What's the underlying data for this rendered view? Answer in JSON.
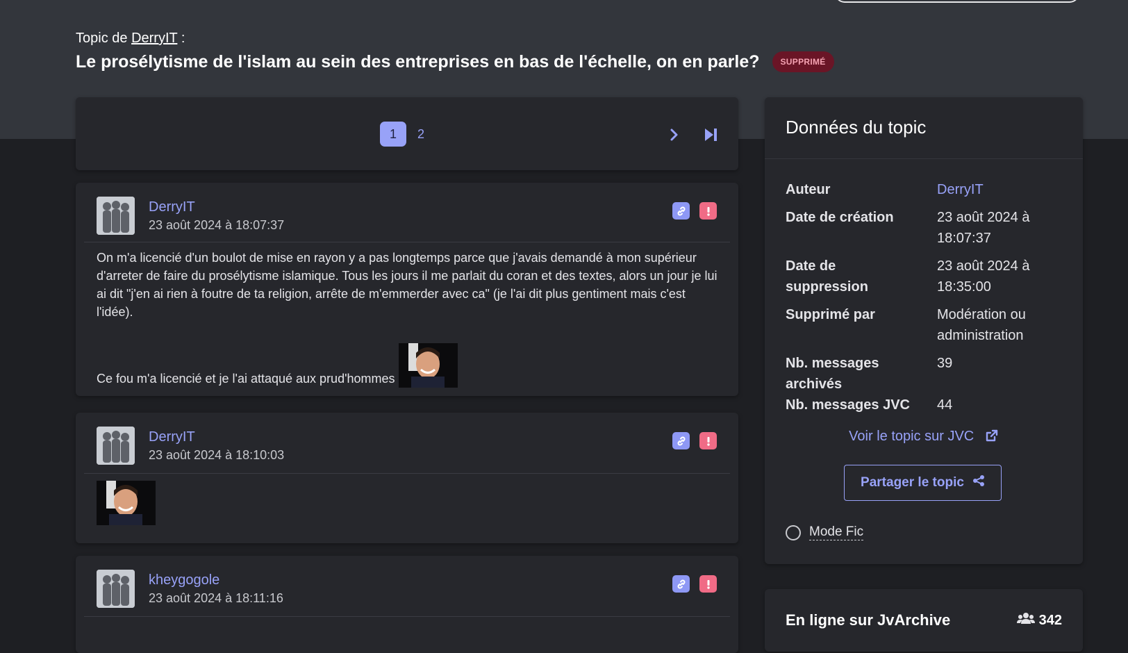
{
  "header": {
    "topic_by_prefix": "Topic de ",
    "topic_author": "DerryIT",
    "topic_by_suffix": " :",
    "title": "Le prosélytisme de l'islam au sein des entreprises en bas de l'échelle, on en parle?",
    "badge": "SUPPRIMÉ"
  },
  "pagination": {
    "pages": [
      "1",
      "2"
    ],
    "current": "1",
    "icons": [
      "chevron-right-icon",
      "skip-to-last-icon"
    ]
  },
  "posts": [
    {
      "author": "DerryIT",
      "date": "23 août 2024 à 18:07:37",
      "paragraphs": [
        "On m'a licencié d'un boulot de mise en rayon y a pas longtemps parce que j'avais demandé à mon supérieur d'arreter de faire du prosélytisme islamique. Tous les jours il me parlait du coran et des textes, alors un jour je lui ai dit \"j'en ai rien à foutre de ta religion, arrête de m'emmerder avec ca\" (je l'ai dit plus gentiment mais c'est l'idée).",
        "Ce fou m'a licencié et je l'ai attaqué aux prud'hommes"
      ]
    },
    {
      "author": "DerryIT",
      "date": "23 août 2024 à 18:10:03"
    },
    {
      "author": "kheygogole",
      "date": "23 août 2024 à 18:11:16"
    }
  ],
  "sidebar": {
    "title": "Données du topic",
    "rows": [
      {
        "label": "Auteur",
        "value": "DerryIT"
      },
      {
        "label": "Date de création",
        "value": "23 août 2024 à 18:07:37"
      },
      {
        "label": "Date de suppression",
        "value": "23 août 2024 à 18:35:00"
      },
      {
        "label": "Supprimé par",
        "value": "Modération ou administration"
      },
      {
        "label": "Nb. messages archivés",
        "value": "39"
      },
      {
        "label": "Nb. messages JVC",
        "value": "44"
      }
    ],
    "jvc_link": "Voir le topic sur JVC",
    "share_button": "Partager le topic",
    "mode_fic": "Mode Fic"
  },
  "online": {
    "title": "En ligne sur JvArchive",
    "count": "342"
  },
  "colors": {
    "accent": "#98a2f8",
    "danger": "#f06b86",
    "badge_bg": "#6a1526",
    "page_bg": "#1e1f23",
    "hero_bg": "#33363c",
    "card_bg": "#26272c"
  }
}
